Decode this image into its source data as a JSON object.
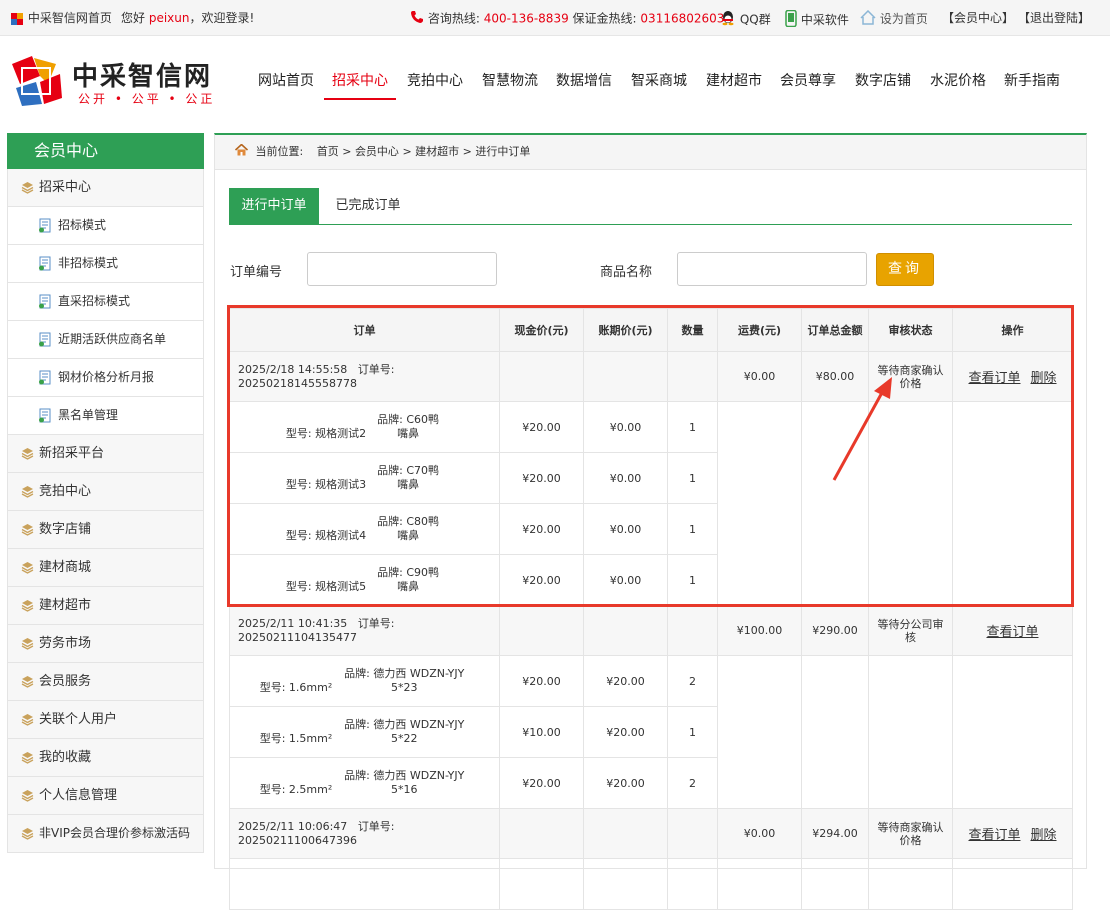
{
  "topbar": {
    "home_link": "中采智信网首页",
    "greeting_prefix": "您好",
    "username": "peixun",
    "greeting_suffix": "，欢迎登录!",
    "hotline_label": "咨询热线:",
    "hotline": "400-136-8839",
    "deposit_label": "保证金热线:",
    "deposit_phone": "031168026032",
    "qq": "QQ群",
    "software": "中采软件",
    "set_home": "设为首页",
    "member_center": "【会员中心】",
    "logout": "【退出登陆】"
  },
  "header": {
    "logo_title": "中采智信网",
    "logo_slogan": "公开 • 公平 • 公正",
    "nav": [
      "网站首页",
      "招采中心",
      "竞拍中心",
      "智慧物流",
      "数据增信",
      "智采商城",
      "建材超市",
      "会员尊享",
      "数字店铺",
      "水泥价格",
      "新手指南"
    ],
    "active_nav": "招采中心"
  },
  "sidebar": {
    "title": "会员中心",
    "groups": [
      {
        "label": "招采中心",
        "children": [
          "招标模式",
          "非招标模式",
          "直采招标模式",
          "近期活跃供应商名单",
          "钢材价格分析月报",
          "黑名单管理"
        ]
      },
      {
        "label": "新招采平台"
      },
      {
        "label": "竞拍中心"
      },
      {
        "label": "数字店铺"
      },
      {
        "label": "建材商城"
      },
      {
        "label": "建材超市"
      },
      {
        "label": "劳务市场"
      },
      {
        "label": "会员服务"
      },
      {
        "label": "关联个人用户"
      },
      {
        "label": "我的收藏"
      },
      {
        "label": "个人信息管理"
      },
      {
        "label": "非VIP会员合理价参标激活码"
      }
    ]
  },
  "breadcrumb": {
    "label": "当前位置:",
    "items": [
      "首页",
      "会员中心",
      "建材超市",
      "进行中订单"
    ],
    "separator": ">"
  },
  "tabs": [
    "进行中订单",
    "已完成订单"
  ],
  "filters": {
    "order_no_label": "订单编号",
    "order_no_value": "",
    "product_label": "商品名称",
    "product_value": "",
    "query_button": "查询"
  },
  "table": {
    "headers": [
      "订单",
      "现金价(元)",
      "账期价(元)",
      "数量",
      "运费(元)",
      "订单总金额",
      "审核状态",
      "操作"
    ],
    "orders": [
      {
        "time": "2025/2/18 14:55:58",
        "order_no_label": "订单号:",
        "order_no": "20250218145558778",
        "freight": "¥0.00",
        "total": "¥80.00",
        "status": "等待商家确认价格",
        "actions": [
          "查看订单",
          "删除"
        ],
        "items": [
          {
            "model": "型号: 规格测试2",
            "brand": "品牌: C60鸭嘴鼻",
            "cash": "¥20.00",
            "term": "¥0.00",
            "qty": "1"
          },
          {
            "model": "型号: 规格测试3",
            "brand": "品牌: C70鸭嘴鼻",
            "cash": "¥20.00",
            "term": "¥0.00",
            "qty": "1"
          },
          {
            "model": "型号: 规格测试4",
            "brand": "品牌: C80鸭嘴鼻",
            "cash": "¥20.00",
            "term": "¥0.00",
            "qty": "1"
          },
          {
            "model": "型号: 规格测试5",
            "brand": "品牌: C90鸭嘴鼻",
            "cash": "¥20.00",
            "term": "¥0.00",
            "qty": "1"
          }
        ]
      },
      {
        "time": "2025/2/11 10:41:35",
        "order_no_label": "订单号:",
        "order_no": "20250211104135477",
        "freight": "¥100.00",
        "total": "¥290.00",
        "status": "等待分公司审核",
        "actions": [
          "查看订单"
        ],
        "items": [
          {
            "model": "型号: 1.6mm²",
            "brand": "品牌: 德力西 WDZN-YJY 5*23",
            "cash": "¥20.00",
            "term": "¥20.00",
            "qty": "2"
          },
          {
            "model": "型号: 1.5mm²",
            "brand": "品牌: 德力西 WDZN-YJY 5*22",
            "cash": "¥10.00",
            "term": "¥20.00",
            "qty": "1"
          },
          {
            "model": "型号: 2.5mm²",
            "brand": "品牌: 德力西 WDZN-YJY 5*16",
            "cash": "¥20.00",
            "term": "¥20.00",
            "qty": "2"
          }
        ]
      },
      {
        "time": "2025/2/11 10:06:47",
        "order_no_label": "订单号:",
        "order_no": "20250211100647396",
        "freight": "¥0.00",
        "total": "¥294.00",
        "status": "等待商家确认价格",
        "actions": [
          "查看订单",
          "删除"
        ],
        "items": []
      }
    ]
  },
  "colors": {
    "brand_green": "#2e9f55",
    "accent_red": "#e60012",
    "query_orange": "#e8a300",
    "highlight_red": "#e8392a"
  }
}
